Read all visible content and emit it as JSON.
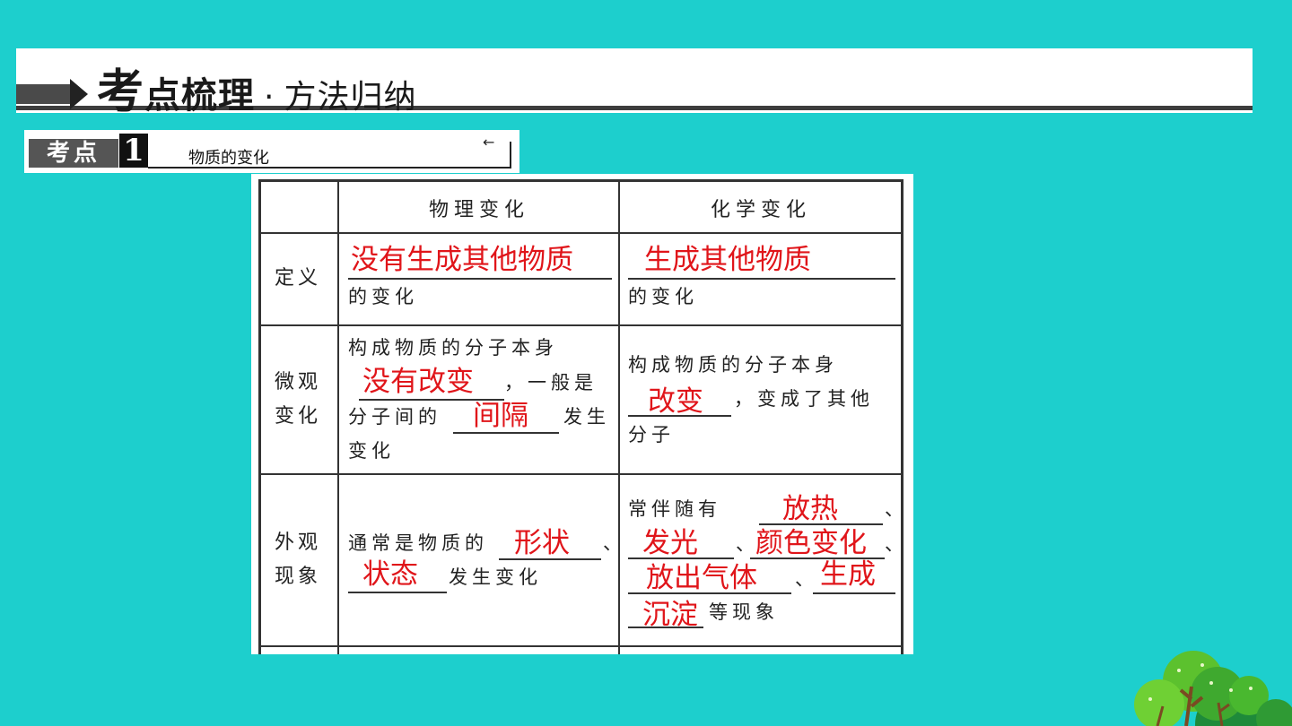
{
  "banner": {
    "title_big": "考",
    "title_rest": "点梳理",
    "dot": "·",
    "subtitle": "方法归纳"
  },
  "section": {
    "tag": "考点",
    "number": "1",
    "label": "物质的变化"
  },
  "table": {
    "headers": [
      "物理变化",
      "化学变化"
    ],
    "rows": [
      {
        "label": "定义",
        "physical": {
          "answer": "没有生成其他物质",
          "text": "的变化"
        },
        "chemical": {
          "answer": "生成其他物质",
          "text": "的变化"
        }
      },
      {
        "label_1": "微观",
        "label_2": "变化",
        "physical": {
          "line1": "构成物质的分子本身",
          "answer1": "没有改变",
          "text1": "，一般是",
          "text2": "分子间的",
          "answer2": "间隔",
          "text3": "发生",
          "text4": "变化"
        },
        "chemical": {
          "line1": "构成物质的分子本身",
          "answer1": "改变",
          "text1": "，变成了其他",
          "text2": "分子"
        }
      },
      {
        "label_1": "外观",
        "label_2": "现象",
        "physical": {
          "text1": "通常是物质的",
          "answer1": "形状",
          "sep1": "、",
          "answer2": "状态",
          "text2": "发生变化"
        },
        "chemical": {
          "text1": "常伴随有",
          "answer1": "放热",
          "sep1": "、",
          "answer2": "发光",
          "sep2": "、",
          "answer3": "颜色变化",
          "sep3": "、",
          "answer4": "放出气体",
          "sep4": "、",
          "answer5": "生成",
          "answer6": "沉淀",
          "text2": "等现象"
        }
      }
    ]
  },
  "colors": {
    "background": "#1dcfcd",
    "answer": "#e0151a"
  },
  "icons": {
    "decoration": "tree-icon"
  }
}
